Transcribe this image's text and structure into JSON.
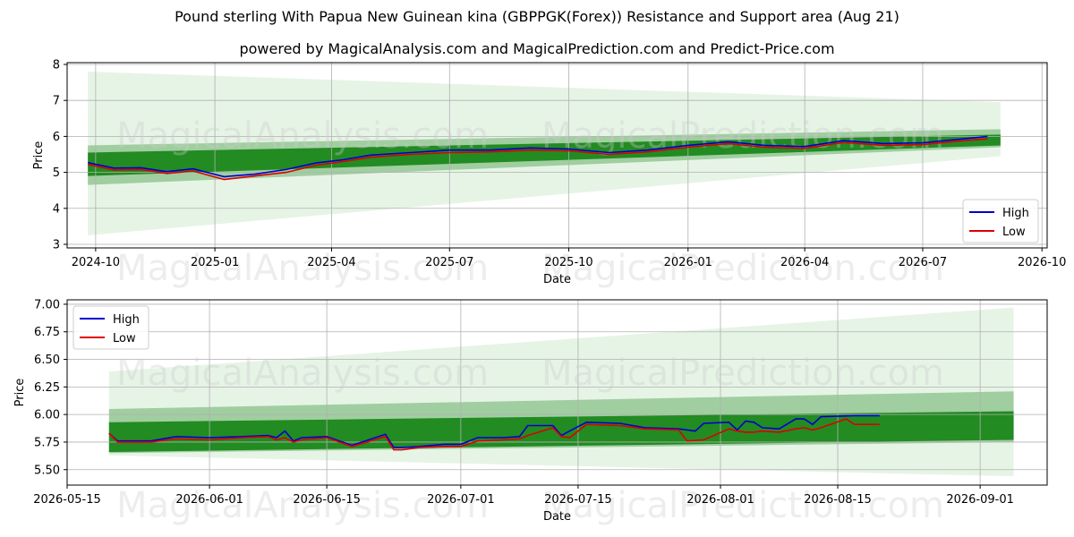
{
  "title": "Pound sterling With Papua New Guinean kina (GBPPGK(Forex)) Resistance and Support area (Aug 21)",
  "subtitle": "powered by MagicalAnalysis.com and MagicalPrediction.com and Predict-Price.com",
  "watermarks": [
    "MagicalAnalysis.com",
    "MagicalPrediction.com"
  ],
  "colors": {
    "high": "#0000cc",
    "low": "#dd0000",
    "band_dark": "#228b22",
    "band_mid": "#5aa85a",
    "band_light": "#c8e6c8"
  },
  "chart_data": [
    {
      "type": "line",
      "xlabel": "Date",
      "ylabel": "Price",
      "x_ticks": [
        "2024-10",
        "2025-01",
        "2025-04",
        "2025-07",
        "2025-10",
        "2026-01",
        "2026-04",
        "2026-07",
        "2026-10"
      ],
      "y_ticks": [
        "3",
        "4",
        "5",
        "6",
        "7",
        "8"
      ],
      "ylim": [
        2.9,
        8.05
      ],
      "xlim": [
        "2024-09-09",
        "2026-10-05"
      ],
      "grid": true,
      "legend": "lower right",
      "series": [
        {
          "name": "High",
          "x": [
            "2024-09-25",
            "2024-10-15",
            "2024-11-05",
            "2024-11-25",
            "2024-12-15",
            "2025-01-08",
            "2025-02-01",
            "2025-02-25",
            "2025-03-20",
            "2025-04-10",
            "2025-05-01",
            "2025-06-01",
            "2025-07-01",
            "2025-08-01",
            "2025-09-01",
            "2025-10-01",
            "2025-11-01",
            "2025-12-01",
            "2026-01-01",
            "2026-02-01",
            "2026-03-01",
            "2026-04-01",
            "2026-05-01",
            "2026-06-01",
            "2026-07-01",
            "2026-08-01",
            "2026-08-20"
          ],
          "values": [
            5.27,
            5.12,
            5.13,
            5.02,
            5.1,
            4.88,
            4.95,
            5.08,
            5.26,
            5.35,
            5.48,
            5.55,
            5.62,
            5.62,
            5.68,
            5.65,
            5.55,
            5.62,
            5.75,
            5.85,
            5.75,
            5.72,
            5.88,
            5.8,
            5.82,
            5.93,
            6.0
          ]
        },
        {
          "name": "Low",
          "x": [
            "2024-09-25",
            "2024-10-15",
            "2024-11-05",
            "2024-11-25",
            "2024-12-15",
            "2025-01-08",
            "2025-02-01",
            "2025-02-25",
            "2025-03-20",
            "2025-04-10",
            "2025-05-01",
            "2025-06-01",
            "2025-07-01",
            "2025-08-01",
            "2025-09-01",
            "2025-10-01",
            "2025-11-01",
            "2025-12-01",
            "2026-01-01",
            "2026-02-01",
            "2026-03-01",
            "2026-04-01",
            "2026-05-01",
            "2026-06-01",
            "2026-07-01",
            "2026-08-01",
            "2026-08-20"
          ],
          "values": [
            5.22,
            5.07,
            5.08,
            4.97,
            5.04,
            4.8,
            4.9,
            5.0,
            5.2,
            5.3,
            5.42,
            5.5,
            5.55,
            5.57,
            5.62,
            5.6,
            5.5,
            5.57,
            5.7,
            5.8,
            5.7,
            5.67,
            5.83,
            5.75,
            5.77,
            5.88,
            5.93
          ]
        }
      ],
      "bands": [
        {
          "x": [
            "2024-09-25",
            "2026-08-30"
          ],
          "lower": [
            3.25,
            5.45
          ],
          "upper": [
            7.8,
            6.95
          ],
          "shade": "light"
        },
        {
          "x": [
            "2024-09-25",
            "2026-08-30"
          ],
          "lower": [
            4.65,
            5.7
          ],
          "upper": [
            5.75,
            6.2
          ],
          "shade": "mid"
        },
        {
          "x": [
            "2024-09-25",
            "2026-08-30"
          ],
          "lower": [
            4.9,
            5.75
          ],
          "upper": [
            5.55,
            6.05
          ],
          "shade": "dark"
        }
      ]
    },
    {
      "type": "line",
      "xlabel": "Date",
      "ylabel": "Price",
      "x_ticks": [
        "2026-05-15",
        "2026-06-01",
        "2026-06-15",
        "2026-07-01",
        "2026-07-15",
        "2026-08-01",
        "2026-08-15",
        "2026-09-01"
      ],
      "y_ticks": [
        "5.50",
        "5.75",
        "6.00",
        "6.25",
        "6.50",
        "6.75",
        "7.00"
      ],
      "ylim": [
        5.36,
        7.04
      ],
      "xlim": [
        "2026-05-15",
        "2026-09-09"
      ],
      "grid": true,
      "legend": "upper left",
      "series": [
        {
          "name": "High",
          "x": [
            "2026-05-20",
            "2026-05-21",
            "2026-05-25",
            "2026-05-28",
            "2026-06-01",
            "2026-06-05",
            "2026-06-08",
            "2026-06-09",
            "2026-06-10",
            "2026-06-11",
            "2026-06-12",
            "2026-06-15",
            "2026-06-18",
            "2026-06-22",
            "2026-06-23",
            "2026-06-24",
            "2026-06-26",
            "2026-06-29",
            "2026-07-01",
            "2026-07-03",
            "2026-07-06",
            "2026-07-08",
            "2026-07-09",
            "2026-07-12",
            "2026-07-13",
            "2026-07-14",
            "2026-07-16",
            "2026-07-20",
            "2026-07-23",
            "2026-07-27",
            "2026-07-29",
            "2026-07-30",
            "2026-08-02",
            "2026-08-03",
            "2026-08-04",
            "2026-08-05",
            "2026-08-06",
            "2026-08-08",
            "2026-08-10",
            "2026-08-11",
            "2026-08-12",
            "2026-08-13",
            "2026-08-17",
            "2026-08-20"
          ],
          "values": [
            5.83,
            5.76,
            5.76,
            5.8,
            5.79,
            5.8,
            5.81,
            5.79,
            5.85,
            5.76,
            5.79,
            5.8,
            5.72,
            5.82,
            5.7,
            5.7,
            5.71,
            5.73,
            5.73,
            5.79,
            5.79,
            5.8,
            5.9,
            5.9,
            5.81,
            5.85,
            5.93,
            5.92,
            5.88,
            5.87,
            5.85,
            5.92,
            5.93,
            5.86,
            5.94,
            5.93,
            5.88,
            5.87,
            5.96,
            5.96,
            5.91,
            5.98,
            5.99,
            5.99
          ]
        },
        {
          "name": "Low",
          "x": [
            "2026-05-20",
            "2026-05-21",
            "2026-05-25",
            "2026-05-28",
            "2026-06-01",
            "2026-06-05",
            "2026-06-08",
            "2026-06-09",
            "2026-06-10",
            "2026-06-11",
            "2026-06-12",
            "2026-06-15",
            "2026-06-18",
            "2026-06-22",
            "2026-06-23",
            "2026-06-24",
            "2026-06-26",
            "2026-06-29",
            "2026-07-01",
            "2026-07-03",
            "2026-07-06",
            "2026-07-08",
            "2026-07-09",
            "2026-07-12",
            "2026-07-13",
            "2026-07-14",
            "2026-07-16",
            "2026-07-20",
            "2026-07-23",
            "2026-07-27",
            "2026-07-28",
            "2026-07-30",
            "2026-08-02",
            "2026-08-03",
            "2026-08-04",
            "2026-08-05",
            "2026-08-06",
            "2026-08-08",
            "2026-08-10",
            "2026-08-11",
            "2026-08-12",
            "2026-08-13",
            "2026-08-16",
            "2026-08-17",
            "2026-08-20"
          ],
          "values": [
            5.83,
            5.75,
            5.75,
            5.78,
            5.77,
            5.79,
            5.8,
            5.77,
            5.79,
            5.75,
            5.77,
            5.79,
            5.71,
            5.8,
            5.68,
            5.68,
            5.7,
            5.71,
            5.71,
            5.76,
            5.77,
            5.78,
            5.81,
            5.88,
            5.8,
            5.79,
            5.91,
            5.9,
            5.87,
            5.86,
            5.76,
            5.77,
            5.87,
            5.85,
            5.84,
            5.84,
            5.85,
            5.84,
            5.87,
            5.88,
            5.86,
            5.88,
            5.96,
            5.91,
            5.91
          ]
        }
      ],
      "bands": [
        {
          "x": [
            "2026-05-20",
            "2026-09-05"
          ],
          "lower": [
            5.63,
            5.44
          ],
          "upper": [
            6.39,
            6.97
          ],
          "shade": "light"
        },
        {
          "x": [
            "2026-05-20",
            "2026-09-05"
          ],
          "lower": [
            5.65,
            5.75
          ],
          "upper": [
            6.05,
            6.21
          ],
          "shade": "mid"
        },
        {
          "x": [
            "2026-05-20",
            "2026-09-05"
          ],
          "lower": [
            5.66,
            5.77
          ],
          "upper": [
            5.93,
            6.03
          ],
          "shade": "dark"
        }
      ]
    }
  ]
}
